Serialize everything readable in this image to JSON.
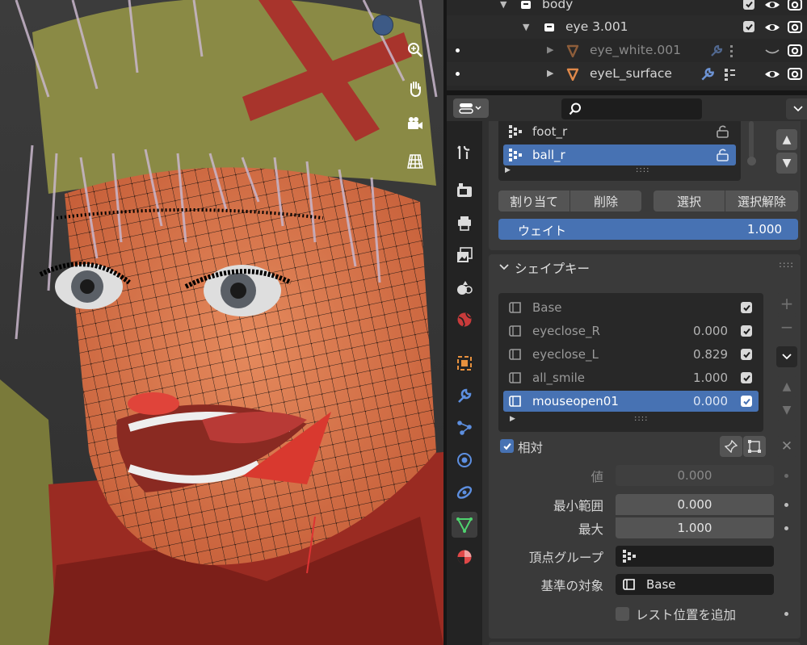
{
  "outliner": {
    "rows": [
      {
        "label": "body"
      },
      {
        "label": "eye 3.001"
      },
      {
        "label": "eye_white.001"
      },
      {
        "label": "eyeL_surface"
      }
    ]
  },
  "properties": {
    "search": {
      "placeholder": ""
    },
    "vertex_groups": {
      "items": [
        {
          "name": "foot_r"
        },
        {
          "name": "ball_r",
          "selected": true
        }
      ],
      "buttons": {
        "assign": "割り当て",
        "remove": "削除",
        "select": "選択",
        "deselect": "選択解除"
      },
      "weight": {
        "label": "ウェイト",
        "value": "1.000"
      }
    },
    "shape_keys": {
      "title": "シェイプキー",
      "items": [
        {
          "name": "Base",
          "value": ""
        },
        {
          "name": "eyeclose_R",
          "value": "0.000"
        },
        {
          "name": "eyeclose_L",
          "value": "0.829"
        },
        {
          "name": "all_smile",
          "value": "1.000"
        },
        {
          "name": "mouseopen01",
          "value": "0.000",
          "selected": true
        }
      ],
      "relative": {
        "label": "相対",
        "checked": true
      },
      "value": {
        "label": "値",
        "value": "0.000"
      },
      "range_min": {
        "label": "最小範囲",
        "value": "0.000"
      },
      "max": {
        "label": "最大",
        "value": "1.000"
      },
      "vertex_group": {
        "label": "頂点グループ",
        "value": ""
      },
      "relative_to": {
        "label": "基準の対象",
        "value": "Base"
      },
      "add_rest_position": {
        "label": "レスト位置を追加",
        "checked": false
      }
    }
  },
  "colors": {
    "accent": "#4772b3",
    "panel": "#3a3a3a",
    "mesh_object": "#e0894a"
  }
}
